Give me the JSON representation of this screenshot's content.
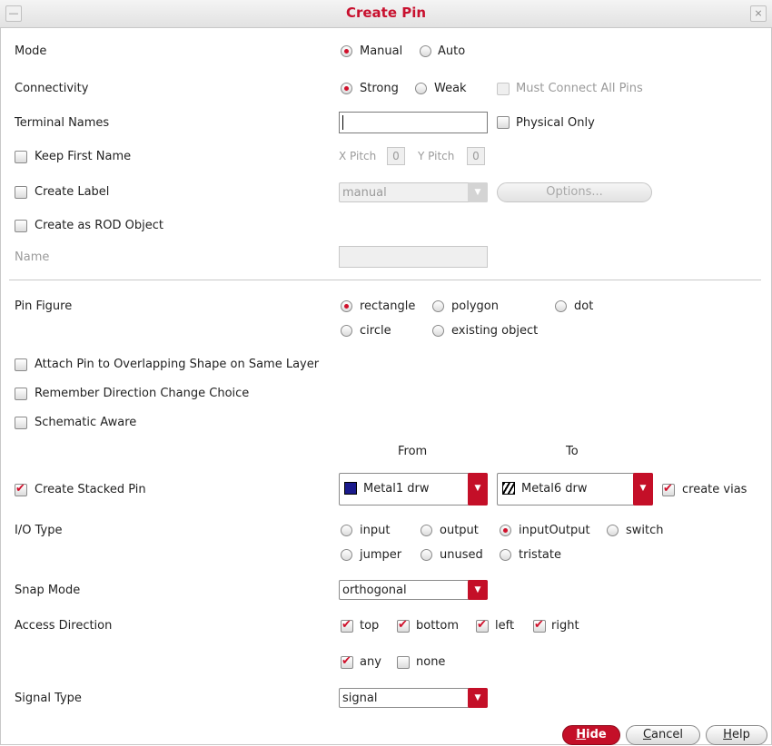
{
  "window": {
    "title": "Create Pin",
    "minimize_glyph": "—",
    "close_glyph": "⨯"
  },
  "mode": {
    "label": "Mode",
    "options": [
      "Manual",
      "Auto"
    ],
    "selected": "Manual"
  },
  "connectivity": {
    "label": "Connectivity",
    "options": [
      "Strong",
      "Weak"
    ],
    "selected": "Strong",
    "must_connect_label": "Must Connect All Pins"
  },
  "terminal_names": {
    "label": "Terminal Names",
    "value": "",
    "physical_only_label": "Physical Only"
  },
  "keep_first_name": {
    "label": "Keep First Name",
    "x_pitch_label": "X Pitch",
    "x_pitch": "0",
    "y_pitch_label": "Y Pitch",
    "y_pitch": "0"
  },
  "create_label": {
    "label": "Create Label",
    "combo_value": "manual",
    "options_button": "Options..."
  },
  "create_rod": {
    "label": "Create as ROD Object",
    "name_label": "Name",
    "name_value": ""
  },
  "pin_figure": {
    "label": "Pin Figure",
    "options": [
      "rectangle",
      "polygon",
      "dot",
      "circle",
      "existing object"
    ],
    "selected": "rectangle"
  },
  "attach_pin": {
    "label": "Attach Pin to Overlapping Shape on Same Layer"
  },
  "remember_direction": {
    "label": "Remember Direction Change Choice"
  },
  "schematic_aware": {
    "label": "Schematic Aware"
  },
  "stacked": {
    "from_label": "From",
    "to_label": "To",
    "label": "Create Stacked Pin",
    "checked": true,
    "from_layer": "Metal1 drw",
    "from_color": "#1a1a8c",
    "to_layer": "Metal6 drw",
    "create_vias_label": "create vias",
    "create_vias": true
  },
  "io_type": {
    "label": "I/O Type",
    "options": [
      "input",
      "output",
      "inputOutput",
      "switch",
      "jumper",
      "unused",
      "tristate"
    ],
    "selected": "inputOutput"
  },
  "snap_mode": {
    "label": "Snap Mode",
    "value": "orthogonal"
  },
  "access_direction": {
    "label": "Access Direction",
    "options": [
      "top",
      "bottom",
      "left",
      "right",
      "any",
      "none"
    ],
    "checked": [
      "top",
      "bottom",
      "left",
      "right",
      "any"
    ]
  },
  "signal_type": {
    "label": "Signal Type",
    "value": "signal"
  },
  "buttons": {
    "hide_prefix": "H",
    "hide_rest": "ide",
    "cancel_prefix": "C",
    "cancel_rest": "ancel",
    "help_prefix": "H",
    "help_rest": "elp"
  },
  "colors": {
    "accent": "#c40f28",
    "title": "#c8102e"
  }
}
